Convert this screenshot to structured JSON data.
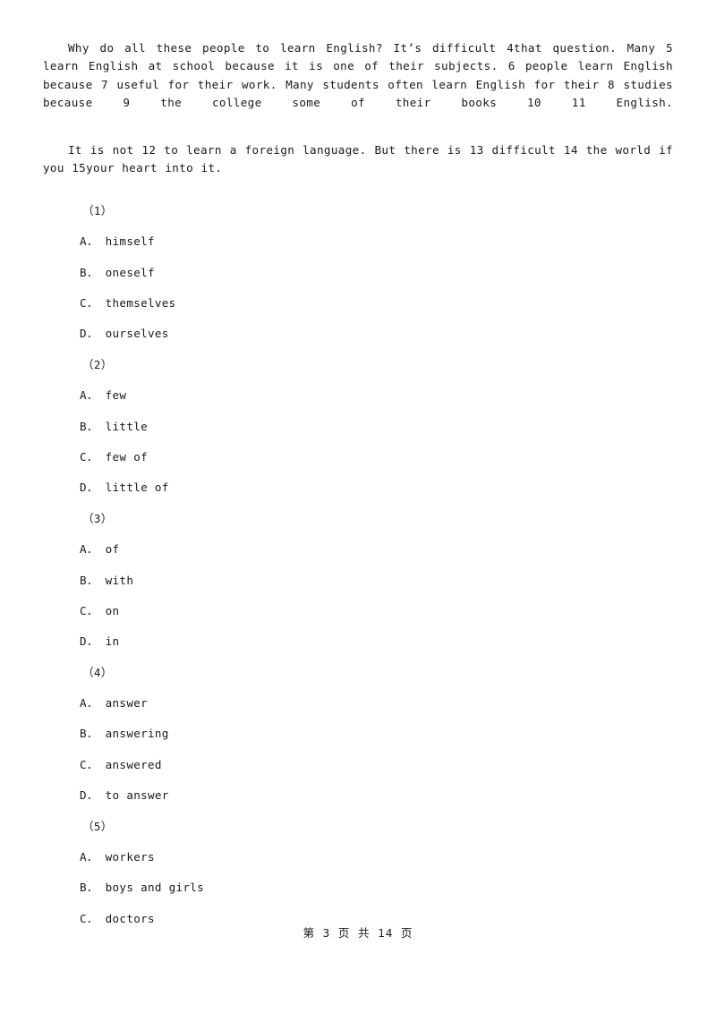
{
  "document": {
    "type": "exam-paper",
    "background_color": "#ffffff",
    "text_color": "#1a1a1a"
  },
  "passage": {
    "paragraphs": [
      "Why do all these people to learn English? It’s difficult 4that question. Many 5 learn English at school because it is one of their subjects. 6 people learn English because 7 useful for their work. Many students often learn English for their 8 studies because 9 the college some of their books 10 11 English.",
      "It is not 12 to learn a foreign language. But there is 13 difficult 14 the world if you 15your heart into it."
    ]
  },
  "questions": [
    {
      "number": "（1）",
      "options": [
        {
          "label": "A．",
          "text": "himself"
        },
        {
          "label": "B．",
          "text": "oneself"
        },
        {
          "label": "C．",
          "text": "themselves"
        },
        {
          "label": "D．",
          "text": "ourselves"
        }
      ]
    },
    {
      "number": "（2）",
      "options": [
        {
          "label": "A．",
          "text": "few"
        },
        {
          "label": "B．",
          "text": "little"
        },
        {
          "label": "C．",
          "text": "few of"
        },
        {
          "label": "D．",
          "text": "little of"
        }
      ]
    },
    {
      "number": "（3）",
      "options": [
        {
          "label": "A．",
          "text": "of"
        },
        {
          "label": "B．",
          "text": "with"
        },
        {
          "label": "C．",
          "text": "on"
        },
        {
          "label": "D．",
          "text": "in"
        }
      ]
    },
    {
      "number": "（4）",
      "options": [
        {
          "label": "A．",
          "text": "answer"
        },
        {
          "label": "B．",
          "text": "answering"
        },
        {
          "label": "C．",
          "text": "answered"
        },
        {
          "label": "D．",
          "text": "to answer"
        }
      ]
    },
    {
      "number": "（5）",
      "options": [
        {
          "label": "A．",
          "text": "workers"
        },
        {
          "label": "B．",
          "text": "boys and girls"
        },
        {
          "label": "C．",
          "text": "doctors"
        }
      ]
    }
  ],
  "footer": {
    "page_label": "第 3 页 共 14 页",
    "current_page": 3,
    "total_pages": 14
  }
}
